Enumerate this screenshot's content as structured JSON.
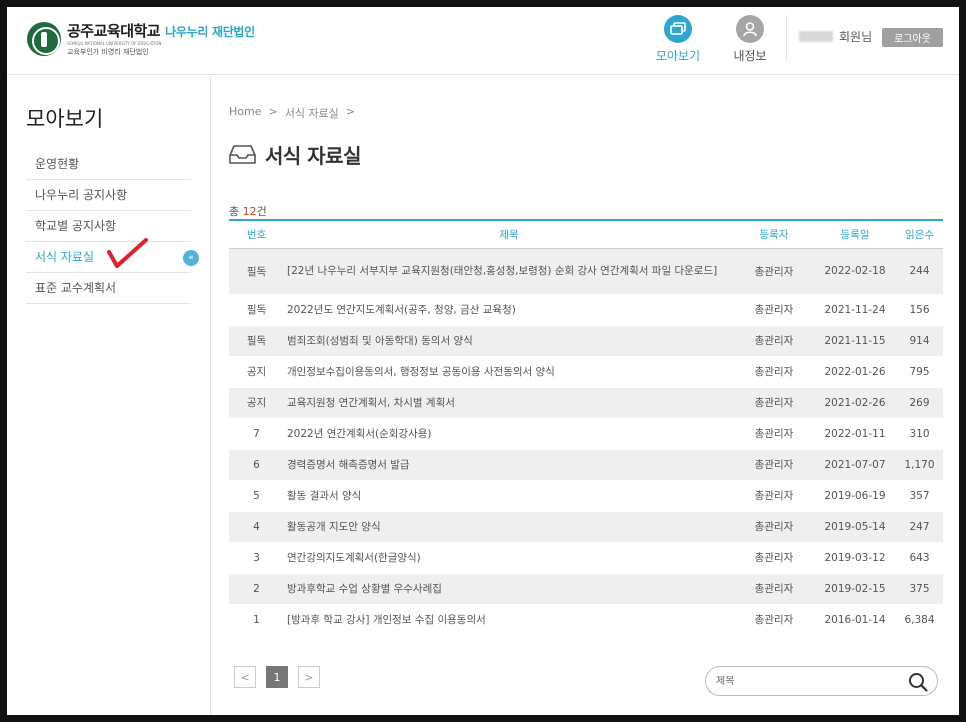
{
  "header": {
    "logo_name": "공주교육대학교",
    "logo_sub": "나우누리 재단법인",
    "logo_eng": "GONGJU NATIONAL UNIVERSITY OF EDUCATION",
    "logo_tag": "교육부인가 비영리 재단법인",
    "nav": [
      {
        "label": "모아보기",
        "icon": "collect-icon",
        "active": true
      },
      {
        "label": "내정보",
        "icon": "user-icon",
        "active": false
      }
    ],
    "user_suffix": "회원님",
    "logout_label": "로그아웃"
  },
  "sidebar": {
    "title": "모아보기",
    "items": [
      {
        "label": "운영현황"
      },
      {
        "label": "나우누리 공지사항"
      },
      {
        "label": "학교별 공지사항"
      },
      {
        "label": "서식 자료실",
        "active": true
      },
      {
        "label": "표준 교수계획서"
      }
    ],
    "active_arrow": "«"
  },
  "main": {
    "breadcrumb": [
      "Home",
      ">",
      "서식 자료실",
      ">"
    ],
    "title": "서식 자료실",
    "total_prefix": "총",
    "total_count": "12",
    "total_suffix": "건",
    "columns": [
      "번호",
      "제목",
      "등록자",
      "등록일",
      "읽은수"
    ],
    "rows": [
      {
        "no": "필독",
        "title": "[22년 나우누리 서부지부 교육지원청(태안청,홍성청,보령청) 순회 강사 연간계획서 파일 다운로드]",
        "author": "총관리자",
        "date": "2022-02-18",
        "views": "244"
      },
      {
        "no": "필독",
        "title": "2022년도 연간지도계획서(공주, 청양, 금산 교육청)",
        "author": "총관리자",
        "date": "2021-11-24",
        "views": "156"
      },
      {
        "no": "필독",
        "title": "범죄조회(성범죄 및 아동학대) 동의서 양식",
        "author": "총관리자",
        "date": "2021-11-15",
        "views": "914"
      },
      {
        "no": "공지",
        "title": "개인정보수집이용동의서, 행정정보 공동이용 사전동의서 양식",
        "author": "총관리자",
        "date": "2022-01-26",
        "views": "795"
      },
      {
        "no": "공지",
        "title": "교육지원청 연간계획서, 차시별 계획서",
        "author": "총관리자",
        "date": "2021-02-26",
        "views": "269"
      },
      {
        "no": "7",
        "title": "2022년 연간계획서(순회강사용)",
        "author": "총관리자",
        "date": "2022-01-11",
        "views": "310"
      },
      {
        "no": "6",
        "title": "경력증명서 해촉증명서 발급",
        "author": "총관리자",
        "date": "2021-07-07",
        "views": "1,170"
      },
      {
        "no": "5",
        "title": "활동 결과서 양식",
        "author": "총관리자",
        "date": "2019-06-19",
        "views": "357"
      },
      {
        "no": "4",
        "title": "활동공개 지도안 양식",
        "author": "총관리자",
        "date": "2019-05-14",
        "views": "247"
      },
      {
        "no": "3",
        "title": "연간강의지도계획서(한글양식)",
        "author": "총관리자",
        "date": "2019-03-12",
        "views": "643"
      },
      {
        "no": "2",
        "title": "방과후학교 수업 상황별 우수사례집",
        "author": "총관리자",
        "date": "2019-02-15",
        "views": "375"
      },
      {
        "no": "1",
        "title": "[방과후 학교 강사] 개인정보 수집 이용동의서",
        "author": "총관리자",
        "date": "2016-01-14",
        "views": "6,384"
      }
    ],
    "pager": {
      "prev": "<",
      "current": "1",
      "next": ">"
    },
    "search": {
      "placeholder": "제목",
      "icon": "search-icon"
    }
  },
  "colors": {
    "accent": "#2ea7cf",
    "count": "#d4431e",
    "annotation": "#e0202a"
  }
}
